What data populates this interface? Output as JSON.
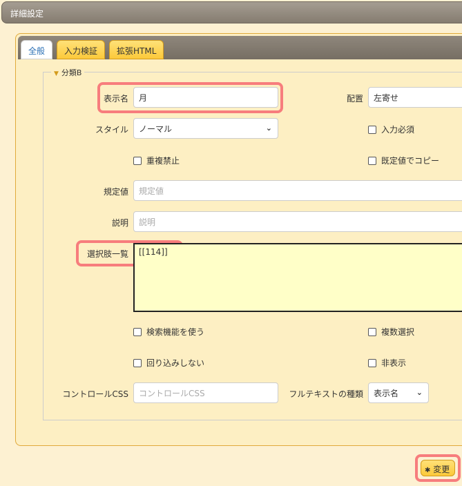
{
  "window": {
    "title": "詳細設定"
  },
  "tabs": [
    {
      "label": "全般"
    },
    {
      "label": "入力検証"
    },
    {
      "label": "拡張HTML"
    }
  ],
  "section": {
    "legend": "分類B"
  },
  "fields": {
    "display_name": {
      "label": "表示名",
      "value": "月"
    },
    "alignment": {
      "label": "配置",
      "value": "左寄せ"
    },
    "style": {
      "label": "スタイル",
      "value": "ノーマル"
    },
    "required": {
      "label": "入力必須"
    },
    "no_duplicate": {
      "label": "重複禁止"
    },
    "copy_default": {
      "label": "既定値でコピー"
    },
    "default_value": {
      "label": "規定値",
      "placeholder": "規定値"
    },
    "description": {
      "label": "説明",
      "placeholder": "説明"
    },
    "choices": {
      "label": "選択肢一覧",
      "value": "[[114]]"
    },
    "use_search": {
      "label": "検索機能を使う"
    },
    "multi_select": {
      "label": "複数選択"
    },
    "no_wrap": {
      "label": "回り込みしない"
    },
    "hidden": {
      "label": "非表示"
    },
    "control_css": {
      "label": "コントロールCSS",
      "placeholder": "コントロールCSS"
    },
    "fulltext_type": {
      "label": "フルテキストの種類",
      "value": "表示名"
    }
  },
  "footer": {
    "change_label": "変更"
  }
}
